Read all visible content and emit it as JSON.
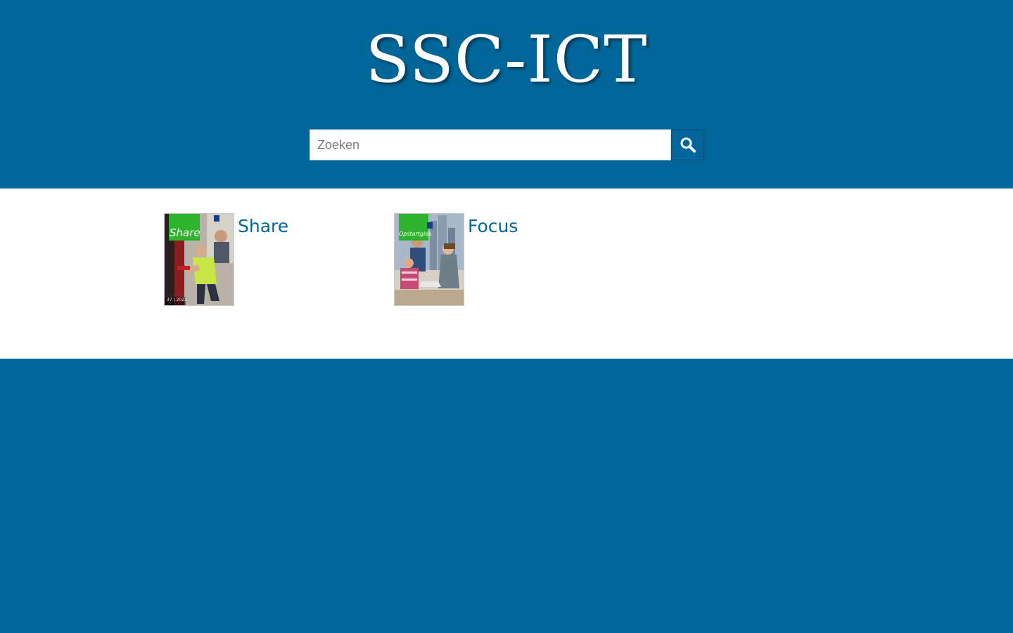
{
  "header": {
    "site_title": "SSC-ICT",
    "search": {
      "placeholder": "Zoeken",
      "value": "",
      "button_icon": "search-icon"
    }
  },
  "publications": [
    {
      "title": "Share",
      "cover_badge": "Share",
      "cover_issue": "37 | 2021"
    },
    {
      "title": "Focus",
      "cover_badge": "Opstartgids",
      "cover_issue": ""
    }
  ],
  "colors": {
    "brand_blue": "#01679a",
    "content_bg": "#ffffff",
    "cover_green": "#2fb32f",
    "link_color": "#01679a"
  }
}
